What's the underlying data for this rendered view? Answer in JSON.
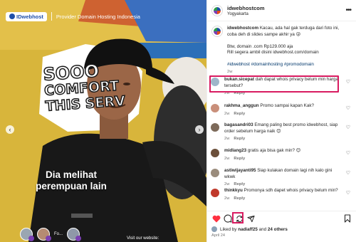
{
  "media": {
    "brand": "IDwebhost",
    "tagline": "Provider Domain Hosting Indonesia",
    "sign_lines": [
      "SOOO",
      "COMFORT",
      "THIS SERV"
    ],
    "overlay_caption": "Dia melihat perempuan lain",
    "nav_prev_glyph": "‹",
    "nav_next_glyph": "›",
    "footer_label": "Fo...",
    "footer_site": "Visit our website:"
  },
  "post": {
    "username": "idwebhostcom",
    "location": "Yogyakarta",
    "caption_user": "idwebhostcom",
    "caption_text": "Kacau, ada hal gak terduga dari foto ini, coba deh di slides sampe akhir ya 😜",
    "caption_promo": "Btw, domain .com Rp129.000 aja",
    "caption_cta": "Rill segera ambil disini idwebhost.com/domain",
    "caption_tags": "#idwebhost #domainhosting #promodomain",
    "caption_time": "2w"
  },
  "comments": [
    {
      "user": "bukan.sicepat",
      "text": "dah dapat whois privacy belum min harga tersebut?",
      "time": "2w",
      "reply": "Reply",
      "avatar_color": "#9eb6c9"
    },
    {
      "user": "rakhma_anggun",
      "text": "Promo sampai kapan Kak?",
      "time": "2w",
      "reply": "Reply",
      "avatar_color": "#c98f7a"
    },
    {
      "user": "bagasandri03",
      "text": "Emang paling best promo idwebhost, siap order sebelum harga naik 😊",
      "time": "2w",
      "reply": "Reply",
      "avatar_color": "#7d6a5a"
    },
    {
      "user": "midlang23",
      "text": "gratis aja bisa gak min? 😊",
      "time": "2w",
      "reply": "Reply",
      "avatar_color": "#6b4f3a"
    },
    {
      "user": "astiwijayanti95",
      "text": "Siap kulakan domain lagi nih kalo gini wkwk",
      "time": "2w",
      "reply": "Reply",
      "avatar_color": "#9a8c7c"
    },
    {
      "user": "thinkkyu",
      "text": "Promonya sdh dapet whois privacy belum min?",
      "time": "2w",
      "reply": "Reply",
      "avatar_color": "#c0392b"
    }
  ],
  "footer": {
    "likes_prefix": "Liked by",
    "likes_user": "nadiaff25",
    "likes_and": "and",
    "likes_others": "24 others",
    "date": "April 24"
  },
  "icons": {
    "heart": "heart-icon",
    "comment": "comment-icon",
    "repost": "repost-icon",
    "share": "share-icon",
    "save": "bookmark-icon",
    "more": "more-icon"
  },
  "colors": {
    "like": "#ff3040",
    "highlight": "#d81b60",
    "link": "#00376b"
  }
}
